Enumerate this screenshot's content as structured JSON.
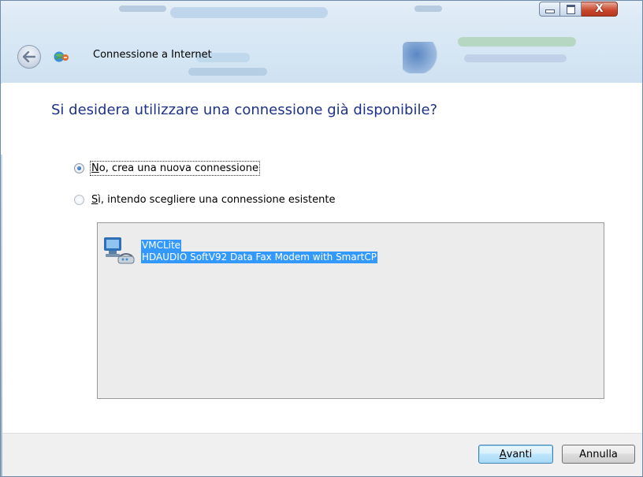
{
  "window": {
    "title": "Connessione a Internet",
    "controls": {
      "minimize_icon": "minimize-icon",
      "maximize_icon": "maximize-icon",
      "close_icon": "close-icon",
      "close_glyph": "X"
    }
  },
  "nav": {
    "back_icon": "back-arrow-icon",
    "app_icon": "network-connection-icon"
  },
  "main": {
    "heading": "Si desidera utilizzare una connessione già disponibile?",
    "options": [
      {
        "access_key": "N",
        "label_rest": "o, crea una nuova connessione",
        "selected": true
      },
      {
        "access_key": "S",
        "label_rest": "ì, intendo scegliere una connessione esistente",
        "selected": false
      }
    ],
    "connections": {
      "item_icon": "modem-icon",
      "lines": [
        "VMCLite",
        "HDAUDIO SoftV92 Data Fax Modem with SmartCP"
      ]
    }
  },
  "footer": {
    "next_key": "A",
    "next_rest": "vanti",
    "cancel_label": "Annulla"
  },
  "colors": {
    "heading": "#1e3287",
    "selection": "#3399ff",
    "listbox_bg": "#ececec"
  }
}
